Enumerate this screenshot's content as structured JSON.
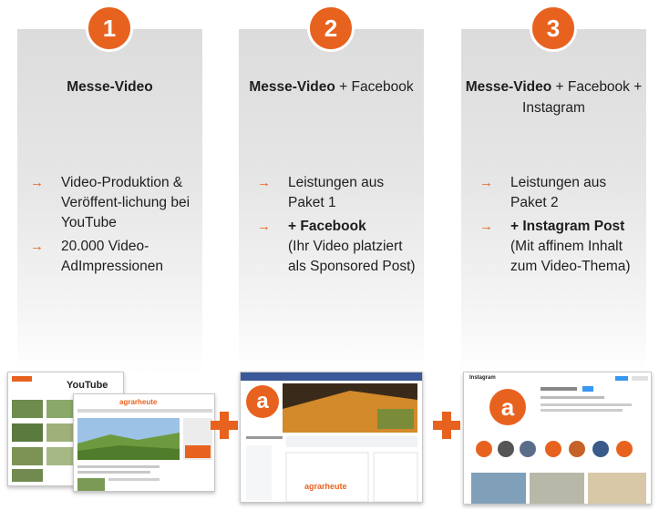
{
  "packages": [
    {
      "number": "1",
      "title_bold": "Messe-Video",
      "title_rest": "",
      "items": [
        {
          "bold": "",
          "text": "Video-Produktion & Veröffent-lichung bei YouTube"
        },
        {
          "bold": "",
          "text": "20.000 Video-AdImpressionen"
        }
      ]
    },
    {
      "number": "2",
      "title_bold": "Messe-Video",
      "title_rest": "+ Facebook",
      "items": [
        {
          "bold": "",
          "text": "Leistungen aus Paket 1"
        },
        {
          "bold": "+ Facebook",
          "text": "(Ihr Video platziert als Sponsored Post)"
        }
      ]
    },
    {
      "number": "3",
      "title_bold": "Messe-Video",
      "title_rest": "+ Facebook + Instagram",
      "items": [
        {
          "bold": "",
          "text": "Leistungen aus Paket 2"
        },
        {
          "bold": "+ Instagram Post",
          "text": "(Mit affinem Inhalt zum Video-Thema)"
        }
      ]
    }
  ],
  "arrow_glyph": "→",
  "plus_glyph": "+",
  "screens": {
    "youtube_logo": "YouTube",
    "site_logo": "agrarheute",
    "instagram_logo": "Instagram"
  },
  "colors": {
    "accent": "#e8621f",
    "panel": "#e3e3e3"
  }
}
